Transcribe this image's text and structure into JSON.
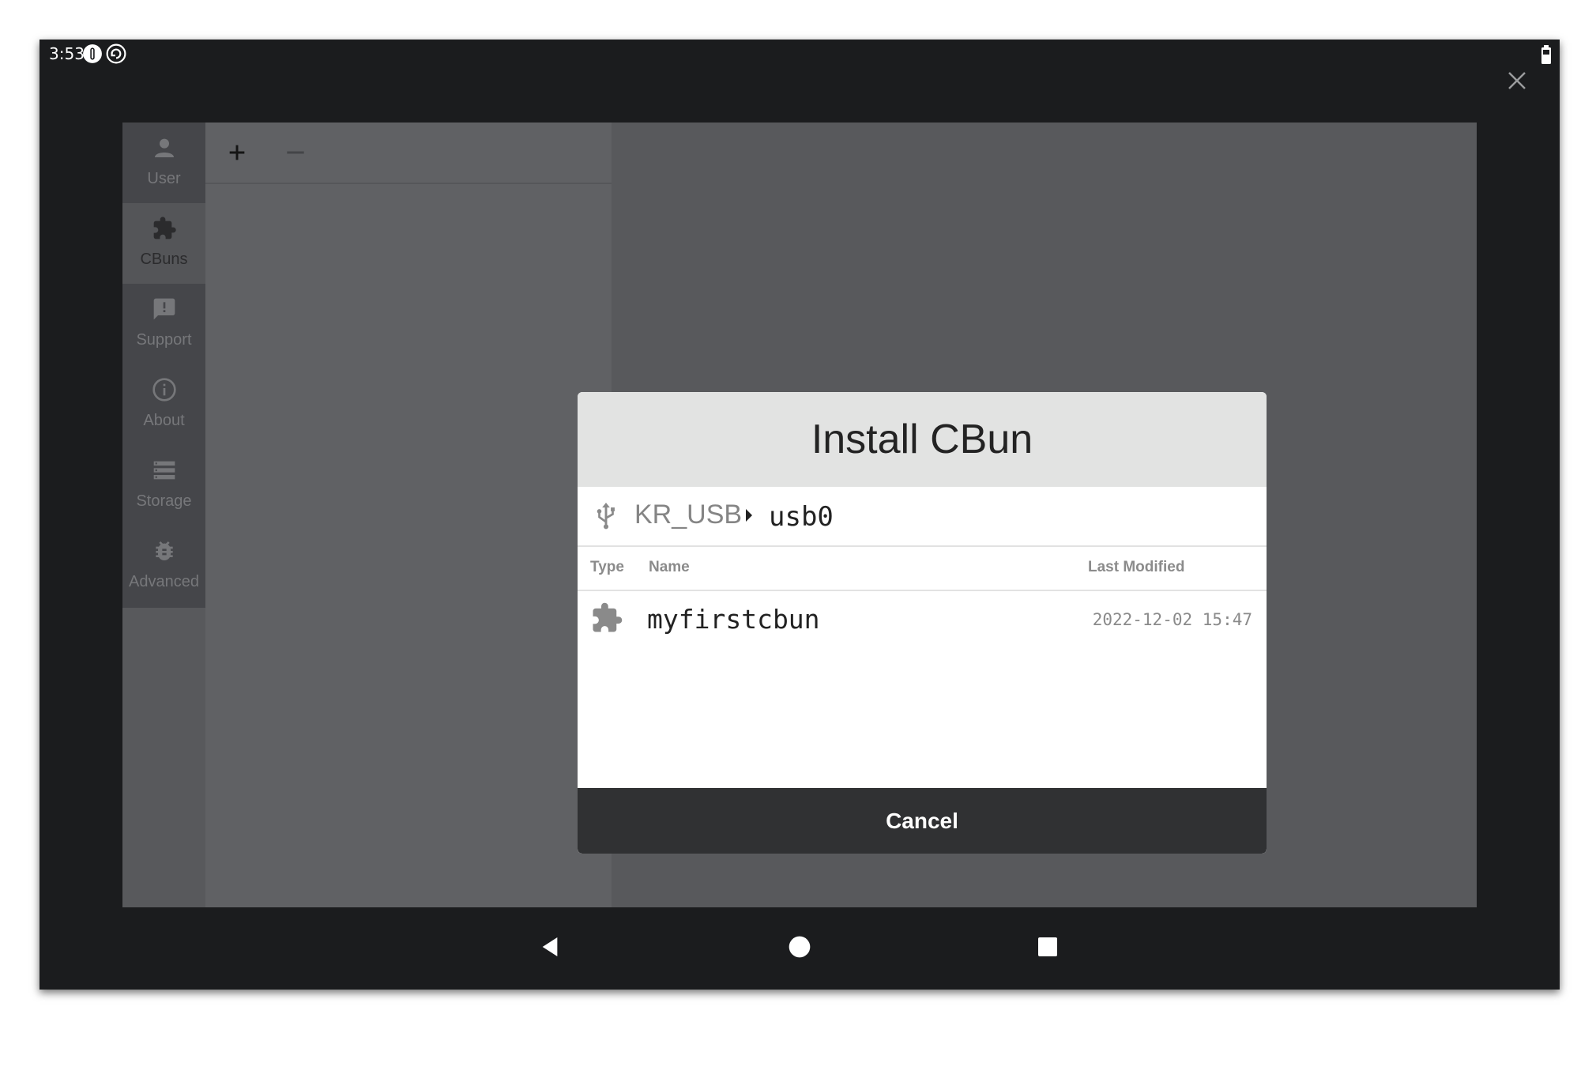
{
  "status_bar": {
    "time": "3:53",
    "icons": [
      "alert-circle-icon",
      "sync-circle-icon",
      "battery-icon"
    ]
  },
  "window": {
    "close_icon": "close-icon"
  },
  "sidebar": {
    "items": [
      {
        "label": "User",
        "icon": "user-icon",
        "active": false
      },
      {
        "label": "CBuns",
        "icon": "puzzle-icon",
        "active": true
      },
      {
        "label": "Support",
        "icon": "feedback-icon",
        "active": false
      },
      {
        "label": "About",
        "icon": "info-icon",
        "active": false
      },
      {
        "label": "Storage",
        "icon": "storage-icon",
        "active": false
      },
      {
        "label": "Advanced",
        "icon": "bug-icon",
        "active": false
      }
    ]
  },
  "list_toolbar": {
    "add_icon": "plus-icon",
    "remove_icon": "minus-icon"
  },
  "dialog": {
    "title": "Install CBun",
    "breadcrumb": {
      "icon": "usb-icon",
      "root": "KR_USB",
      "separator_icon": "caret-right-icon",
      "current": "usb0"
    },
    "columns": {
      "type": "Type",
      "name": "Name",
      "modified": "Last Modified"
    },
    "rows": [
      {
        "type_icon": "puzzle-icon",
        "name": "myfirstcbun",
        "modified": "2022-12-02 15:47"
      }
    ],
    "cancel_label": "Cancel"
  },
  "nav_bar": {
    "buttons": [
      "back-icon",
      "home-icon",
      "recents-icon"
    ]
  },
  "colors": {
    "device_bg": "#1b1c1e",
    "app_bg": "#58595c",
    "sidebar_bg": "#45464a",
    "dialog_header_bg": "#e2e3e2",
    "cancel_bg": "#303133"
  }
}
